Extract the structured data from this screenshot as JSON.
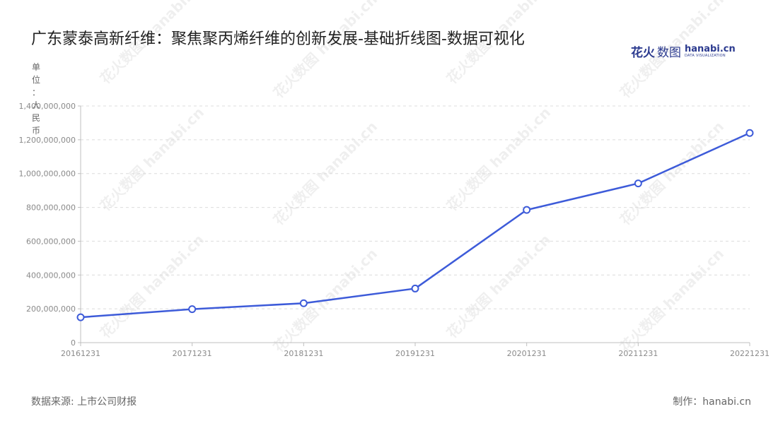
{
  "title": "广东蒙泰高新纤维：聚焦聚丙烯纤维的创新发展-基础折线图-数据可视化",
  "brand": {
    "cn_bold": "花火",
    "cn_light": "数图",
    "en": "hanabi.cn",
    "en_sub": "DATA VISUALIZATION"
  },
  "watermark_text": "花火数图 hanabi.cn",
  "footer": {
    "source": "数据来源: 上市公司财报",
    "credit": "制作：hanabi.cn"
  },
  "colors": {
    "line": "#3d5bd9",
    "grid": "#dcdcdc",
    "axis": "#bfbfbf",
    "marker_fill": "#ffffff"
  },
  "chart_data": {
    "type": "line",
    "title": "广东蒙泰高新纤维：聚焦聚丙烯纤维的创新发展-基础折线图-数据可视化",
    "xlabel": "",
    "ylabel": "单位：人民币",
    "x": [
      "20161231",
      "20171231",
      "20181231",
      "20191231",
      "20201231",
      "20211231",
      "20221231"
    ],
    "values": [
      150000000,
      198000000,
      233000000,
      320000000,
      785000000,
      942000000,
      1240000000
    ],
    "ylim": [
      0,
      1400000000
    ],
    "yticks": [
      0,
      200000000,
      400000000,
      600000000,
      800000000,
      1000000000,
      1200000000,
      1400000000
    ],
    "ytick_labels": [
      "0",
      "200,000,000",
      "400,000,000",
      "600,000,000",
      "800,000,000",
      "1,000,000,000",
      "1,200,000,000",
      "1,400,000,000"
    ],
    "grid": true,
    "legend": "none"
  }
}
